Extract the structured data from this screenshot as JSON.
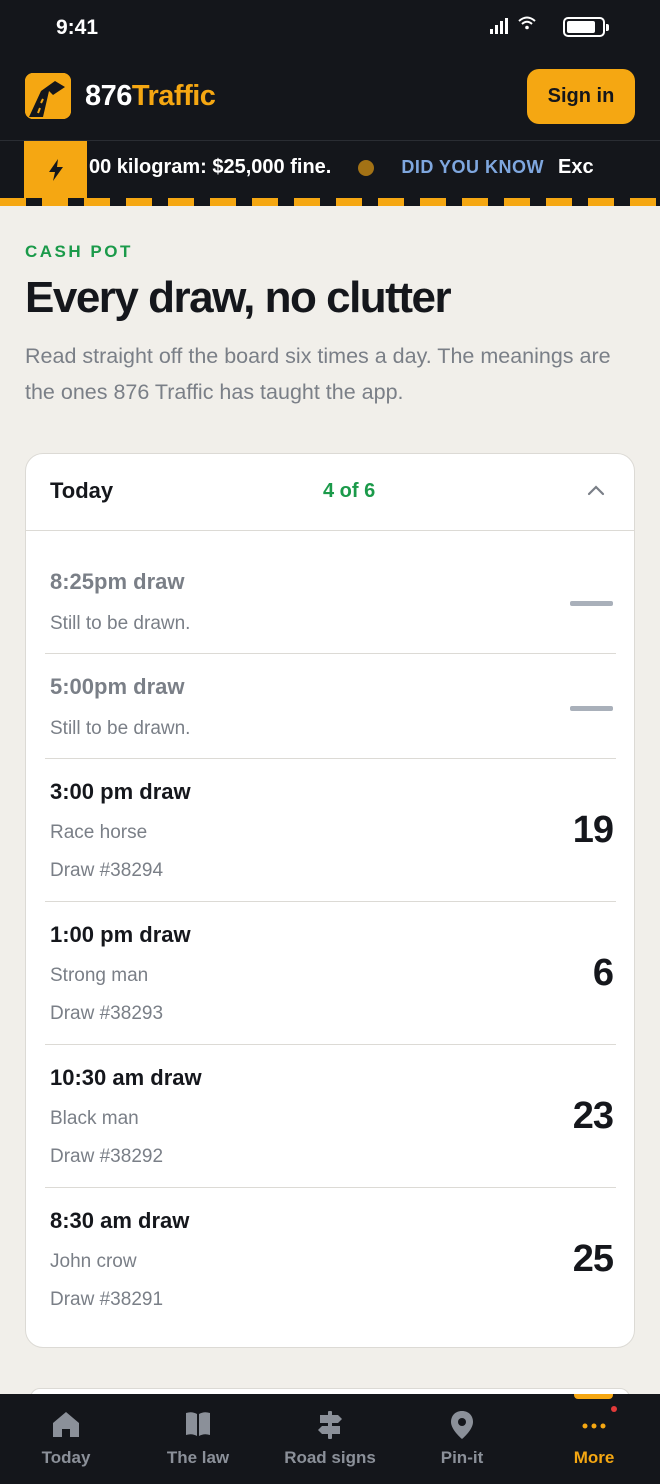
{
  "status": {
    "time": "9:41"
  },
  "header": {
    "brand_a": "876",
    "brand_b": "Traffic",
    "signin_label": "Sign in"
  },
  "ticker": {
    "text": "00 kilogram: $25,000 fine.",
    "label": "DID YOU KNOW",
    "text2": "Exc"
  },
  "section": {
    "eyebrow": "CASH POT",
    "title": "Every draw, no clutter",
    "lede": "Read straight off the board six times a day. The meanings are the ones 876 Traffic has taught the app."
  },
  "card": {
    "title": "Today",
    "count": "4 of 6",
    "draws": [
      {
        "time": "8:25pm draw",
        "meaning": "Still to be drawn.",
        "status": "pending"
      },
      {
        "time": "5:00pm draw",
        "meaning": "Still to be drawn.",
        "status": "pending"
      },
      {
        "time": "3:00 pm draw",
        "meaning": "Race horse",
        "draw_no": "Draw #38294",
        "number": "19",
        "status": "drawn"
      },
      {
        "time": "1:00 pm draw",
        "meaning": "Strong man",
        "draw_no": "Draw #38293",
        "number": "6",
        "status": "drawn"
      },
      {
        "time": "10:30 am draw",
        "meaning": "Black man",
        "draw_no": "Draw #38292",
        "number": "23",
        "status": "drawn"
      },
      {
        "time": "8:30 am draw",
        "meaning": "John crow",
        "draw_no": "Draw #38291",
        "number": "25",
        "status": "drawn"
      }
    ]
  },
  "nav": {
    "items": [
      {
        "label": "Today",
        "icon": "home-icon"
      },
      {
        "label": "The law",
        "icon": "book-icon"
      },
      {
        "label": "Road signs",
        "icon": "signpost-icon"
      },
      {
        "label": "Pin-it",
        "icon": "map-pin-icon"
      },
      {
        "label": "More",
        "icon": "more-dots-icon",
        "active": true
      }
    ]
  },
  "colors": {
    "accent": "#f5a712",
    "dark": "#14161b",
    "green": "#1b9a4a",
    "muted": "#7a7f87",
    "link_blue": "#7fa7df"
  }
}
